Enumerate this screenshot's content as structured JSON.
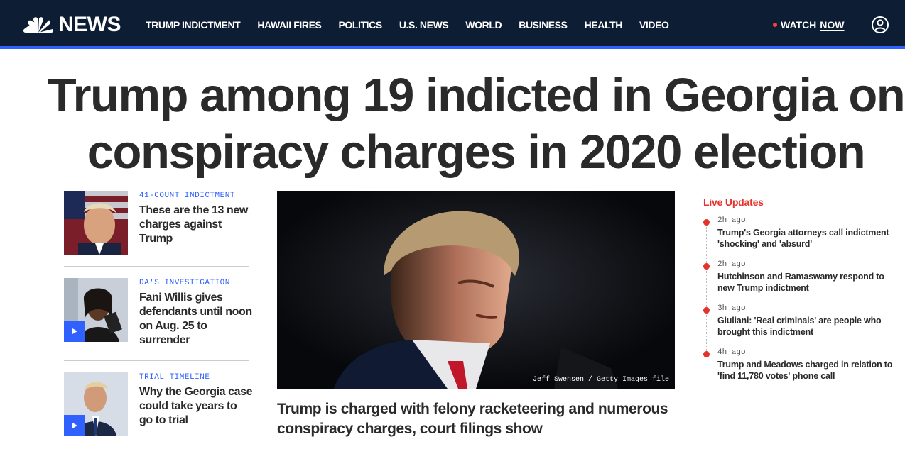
{
  "header": {
    "logo_text": "NEWS",
    "nav": [
      "TRUMP INDICTMENT",
      "HAWAII FIRES",
      "POLITICS",
      "U.S. NEWS",
      "WORLD",
      "BUSINESS",
      "HEALTH",
      "VIDEO"
    ],
    "watch_label": "WATCH",
    "watch_now": "NOW",
    "colors": {
      "bar": "#0d1d33",
      "accent": "#3061ff",
      "live": "#e5322b"
    }
  },
  "headline": {
    "line1": "Trump among 19 indicted in Georgia on",
    "line2": "conspiracy charges in 2020 election"
  },
  "left_stories": [
    {
      "eyebrow": "41-COUNT INDICTMENT",
      "title": "These are the 13 new charges against Trump",
      "has_video": false
    },
    {
      "eyebrow": "DA'S INVESTIGATION",
      "title": "Fani Willis gives defendants until noon on Aug. 25 to surrender",
      "has_video": true
    },
    {
      "eyebrow": "TRIAL TIMELINE",
      "title": "Why the Georgia case could take years to go to trial",
      "has_video": true
    }
  ],
  "hero": {
    "credit": "Jeff Swensen / Getty Images file",
    "caption": "Trump is charged with felony racketeering and numerous conspiracy charges, court filings show"
  },
  "live_updates": {
    "title": "Live Updates",
    "items": [
      {
        "time": "2h ago",
        "text": "Trump's Georgia attorneys call indictment 'shocking' and 'absurd'"
      },
      {
        "time": "2h ago",
        "text": "Hutchinson and Ramaswamy respond to new Trump indictment"
      },
      {
        "time": "3h ago",
        "text": "Giuliani: 'Real criminals' are people who brought this indictment"
      },
      {
        "time": "4h ago",
        "text": "Trump and Meadows charged in relation to 'find 11,780 votes' phone call"
      }
    ]
  }
}
